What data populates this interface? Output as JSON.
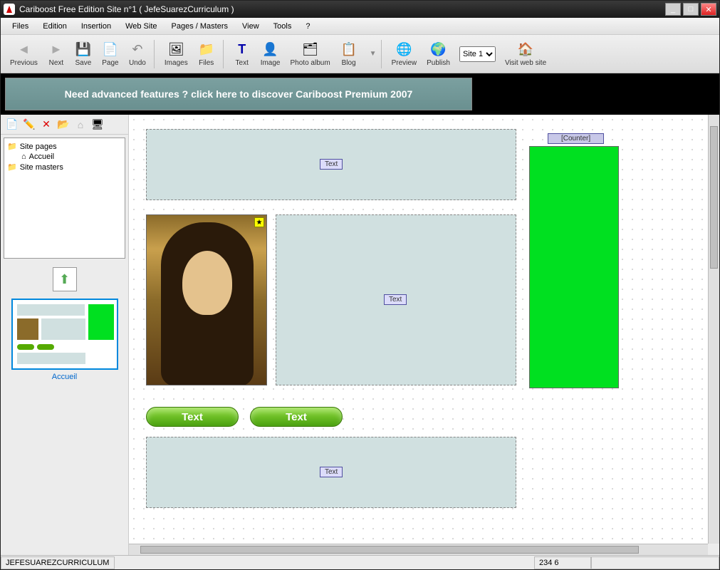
{
  "window": {
    "title": "Cariboost Free Edition Site n°1 ( JefeSuarezCurriculum )"
  },
  "menu": [
    "Files",
    "Edition",
    "Insertion",
    "Web Site",
    "Pages / Masters",
    "View",
    "Tools",
    "?"
  ],
  "toolbar": [
    {
      "id": "previous",
      "label": "Previous",
      "icon": "◄"
    },
    {
      "id": "next",
      "label": "Next",
      "icon": "►"
    },
    {
      "id": "save",
      "label": "Save",
      "icon": "💾"
    },
    {
      "id": "page",
      "label": "Page",
      "icon": "📄"
    },
    {
      "id": "undo",
      "label": "Undo",
      "icon": "↶"
    },
    {
      "id": "images",
      "label": "Images",
      "icon": "🖼"
    },
    {
      "id": "files",
      "label": "Files",
      "icon": "📁"
    },
    {
      "id": "text",
      "label": "Text",
      "icon": "T"
    },
    {
      "id": "image",
      "label": "Image",
      "icon": "👤"
    },
    {
      "id": "photoalbum",
      "label": "Photo album",
      "icon": "🗂"
    },
    {
      "id": "blog",
      "label": "Blog",
      "icon": "📋"
    },
    {
      "id": "preview",
      "label": "Preview",
      "icon": "🌐"
    },
    {
      "id": "publish",
      "label": "Publish",
      "icon": "🌍"
    },
    {
      "id": "visitwebsite",
      "label": "Visit web site",
      "icon": "🏠"
    }
  ],
  "site_select": {
    "options": [
      "Site 1"
    ],
    "selected": "Site 1"
  },
  "banner": "Need advanced features ? click here to discover Cariboost Premium 2007",
  "tree": {
    "root1": "Site pages",
    "child1": "Accueil",
    "root2": "Site masters"
  },
  "thumbnail_label": "Accueil",
  "canvas": {
    "text_label": "Text",
    "counter_label": "[Counter]",
    "btn1": "Text",
    "btn2": "Text"
  },
  "status": {
    "left": "JEFESUAREZCURRICULUM",
    "coords": "234 6"
  }
}
